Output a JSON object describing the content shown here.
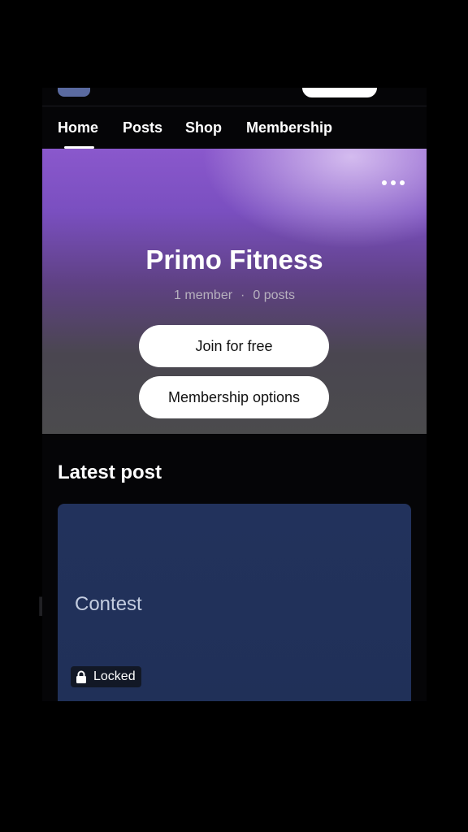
{
  "nav": {
    "tabs": [
      {
        "label": "Home",
        "active": true
      },
      {
        "label": "Posts",
        "active": false
      },
      {
        "label": "Shop",
        "active": false
      },
      {
        "label": "Membership",
        "active": false
      }
    ]
  },
  "hero": {
    "title": "Primo Fitness",
    "members": "1 member",
    "separator": "·",
    "posts": "0 posts",
    "join_label": "Join for free",
    "membership_label": "Membership options",
    "more_icon": "more-horizontal-icon"
  },
  "latest": {
    "heading": "Latest post",
    "post_title": "Contest",
    "locked_label": "Locked",
    "lock_icon": "lock-icon"
  },
  "colors": {
    "accent_purple": "#8a58cc",
    "card_blue": "#22325c",
    "background": "#050507"
  }
}
